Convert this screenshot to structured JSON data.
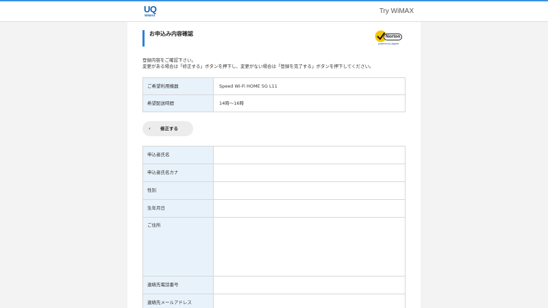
{
  "header": {
    "logo_text": "UQ",
    "logo_sub": "WiMAX",
    "right_link": "Try WiMAX"
  },
  "page": {
    "title": "お申込み内容確認",
    "intro_line1": "登録内容をご確認下さい。",
    "intro_line2": "変更がある場合は「修正する」ボタンを押下し、変更がない場合は「登録を完了する」ボタンを押下してください。"
  },
  "norton": {
    "word": "Norton",
    "sub": "powered by digicert"
  },
  "order_table": [
    {
      "label": "ご希望利用機器",
      "value": "Speed Wi-Fi HOME 5G L11"
    },
    {
      "label": "希望配送時間",
      "value": "14時〜16時"
    }
  ],
  "fix_button": {
    "label": "修正する",
    "chevron": "‹"
  },
  "applicant_table": [
    {
      "label": "申込者氏名",
      "value": ""
    },
    {
      "label": "申込者氏名カナ",
      "value": ""
    },
    {
      "label": "性別",
      "value": ""
    },
    {
      "label": "生年月日",
      "value": ""
    },
    {
      "label": "ご住所",
      "value": ""
    },
    {
      "label": "連絡先電話番号",
      "value": ""
    },
    {
      "label": "連絡先メールアドレス",
      "value": ""
    }
  ],
  "colors": {
    "accent": "#2b7de0",
    "brand": "#0b61b5",
    "label_bg": "#e8f2fb",
    "border": "#d6d6d6"
  }
}
